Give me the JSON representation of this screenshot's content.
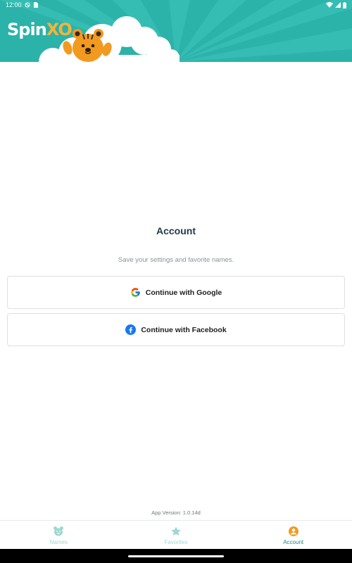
{
  "status_bar": {
    "time": "12:00"
  },
  "brand": {
    "spin": "Spin",
    "xo": "XO"
  },
  "account": {
    "title": "Account",
    "subtitle": "Save your settings and favorite names."
  },
  "auth": {
    "google_label": "Continue with Google",
    "facebook_label": "Continue with Facebook"
  },
  "version": "App Version: 1.0.14d",
  "nav": {
    "names": "Names",
    "favorites": "Favorites",
    "account": "Account",
    "active": "account"
  },
  "colors": {
    "header": "#2bb2a9",
    "accent_orange": "#f29a1f",
    "nav_active": "#1a8a85",
    "nav_inactive": "#9fd8d3",
    "facebook_blue": "#1877f2"
  },
  "icons": {
    "names": "bear-face-icon",
    "favorites": "star-icon",
    "account": "user-circle-icon"
  }
}
